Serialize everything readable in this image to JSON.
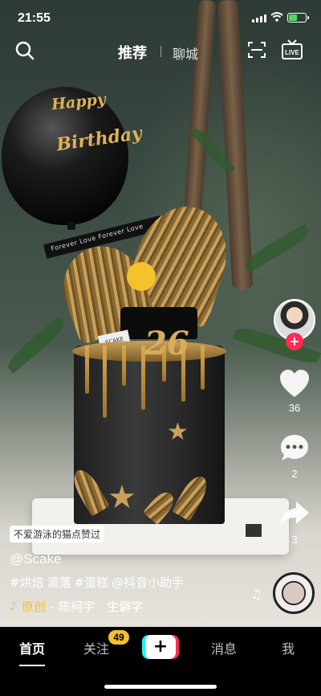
{
  "status": {
    "time": "21:55"
  },
  "topnav": {
    "tab_recommend": "推荐",
    "tab_city": "聊城"
  },
  "video": {
    "balloon_line1": "Happy",
    "balloon_line2": "Birthday",
    "ribbon_text": "Forever Love Forever Love",
    "cake_number": "26",
    "card_text": "SCAKE"
  },
  "rail": {
    "likes": "36",
    "comments": "2",
    "shares": "3"
  },
  "caption": {
    "liked_by": "不爱游泳的猫点赞过",
    "author": "@Scake",
    "tags": [
      "#烘焙",
      "滴落",
      "#蛋糕",
      "@抖音小助手"
    ],
    "music_original": "原创",
    "music_credit": "- 陈柯宇　生僻字"
  },
  "tabbar": {
    "home": "首页",
    "follow": "关注",
    "follow_badge": "49",
    "add": "+",
    "messages": "消息",
    "me": "我"
  },
  "colors": {
    "accent_red": "#fe2c55",
    "accent_cyan": "#25f4ee",
    "badge_yellow": "#f3c22c"
  }
}
